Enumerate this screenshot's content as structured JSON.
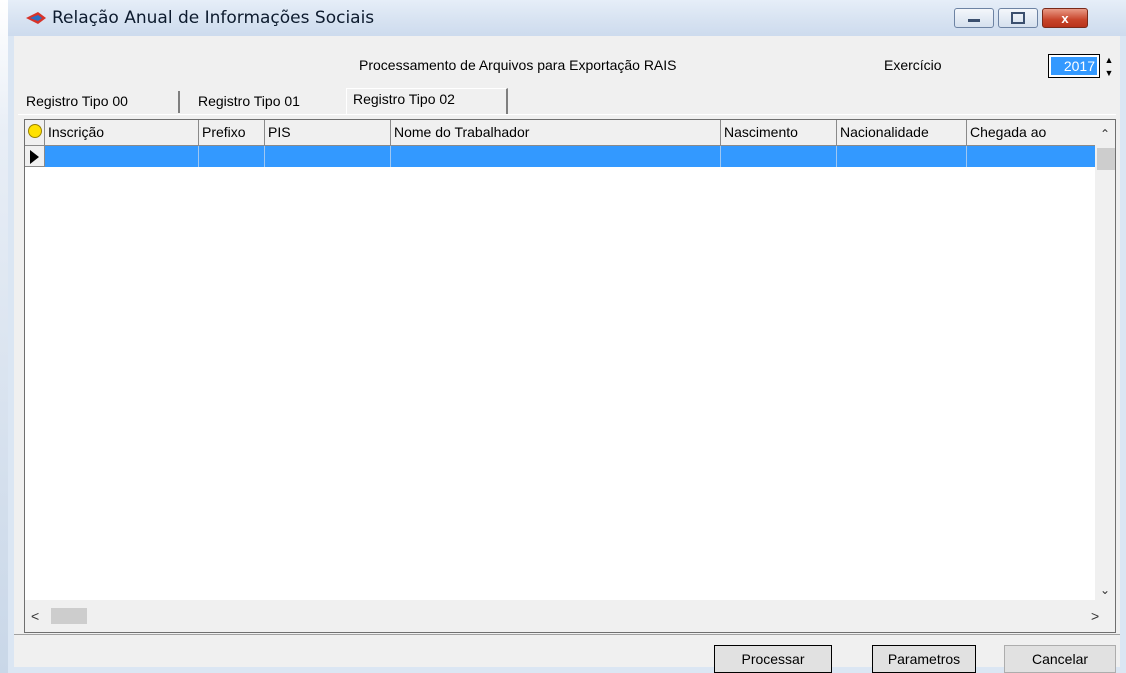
{
  "window": {
    "title": "Relação Anual de Informações Sociais",
    "controls": {
      "minimize": "–",
      "maximize": "□",
      "close": "x"
    }
  },
  "header": {
    "process_title": "Processamento de Arquivos para Exportação RAIS",
    "exercicio_label": "Exercício",
    "exercicio_value": "2017"
  },
  "tabs": [
    {
      "label": "Registro Tipo 00",
      "active": false
    },
    {
      "label": "Registro Tipo 01",
      "active": false
    },
    {
      "label": "Registro Tipo 02",
      "active": true
    }
  ],
  "grid": {
    "columns": [
      "Inscrição",
      "Prefixo",
      "PIS",
      "Nome do Trabalhador",
      "Nascimento",
      "Nacionalidade",
      "Chegada ao"
    ],
    "rows": [
      [
        "",
        "",
        "",
        "",
        "",
        "",
        ""
      ]
    ],
    "selection_color": "#3399ff"
  },
  "buttons": {
    "processar": "Processar",
    "parametros": "Parametros",
    "cancelar": "Cancelar"
  }
}
